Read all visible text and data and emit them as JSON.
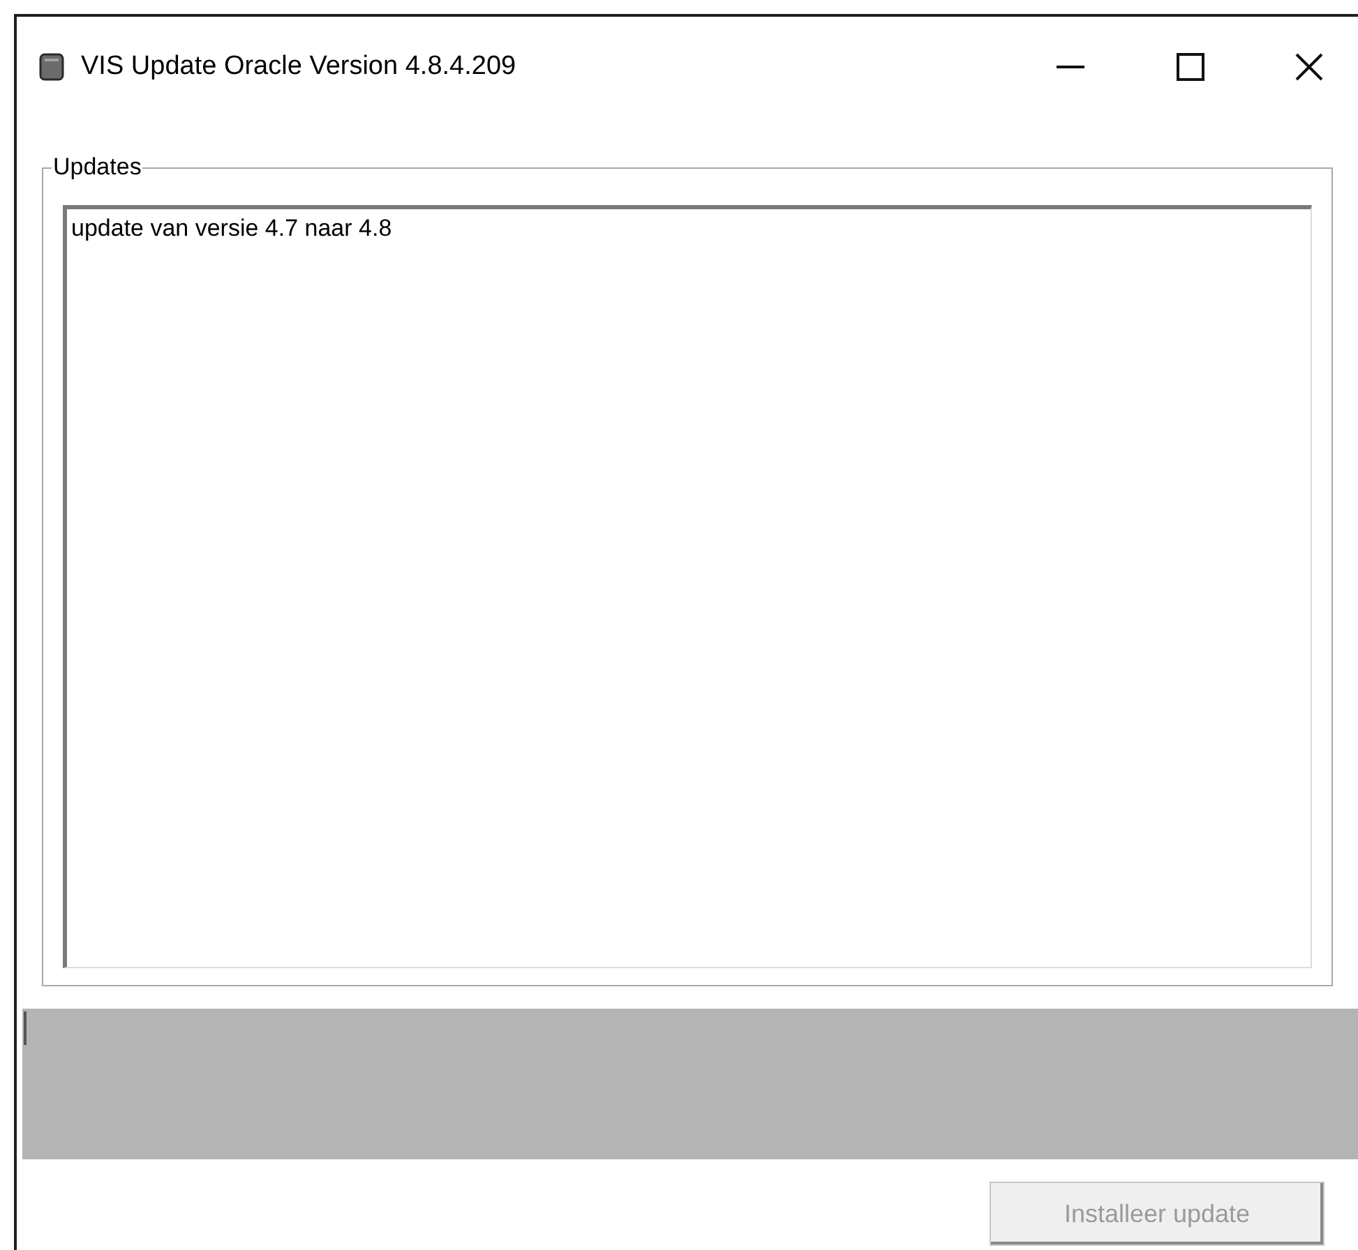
{
  "window": {
    "title": "VIS Update Oracle Version 4.8.4.209"
  },
  "updates_group": {
    "label": "Updates",
    "items": [
      "update van versie 4.7 naar 4.8"
    ]
  },
  "install_button": {
    "label": "Installeer update",
    "disabled": true
  }
}
